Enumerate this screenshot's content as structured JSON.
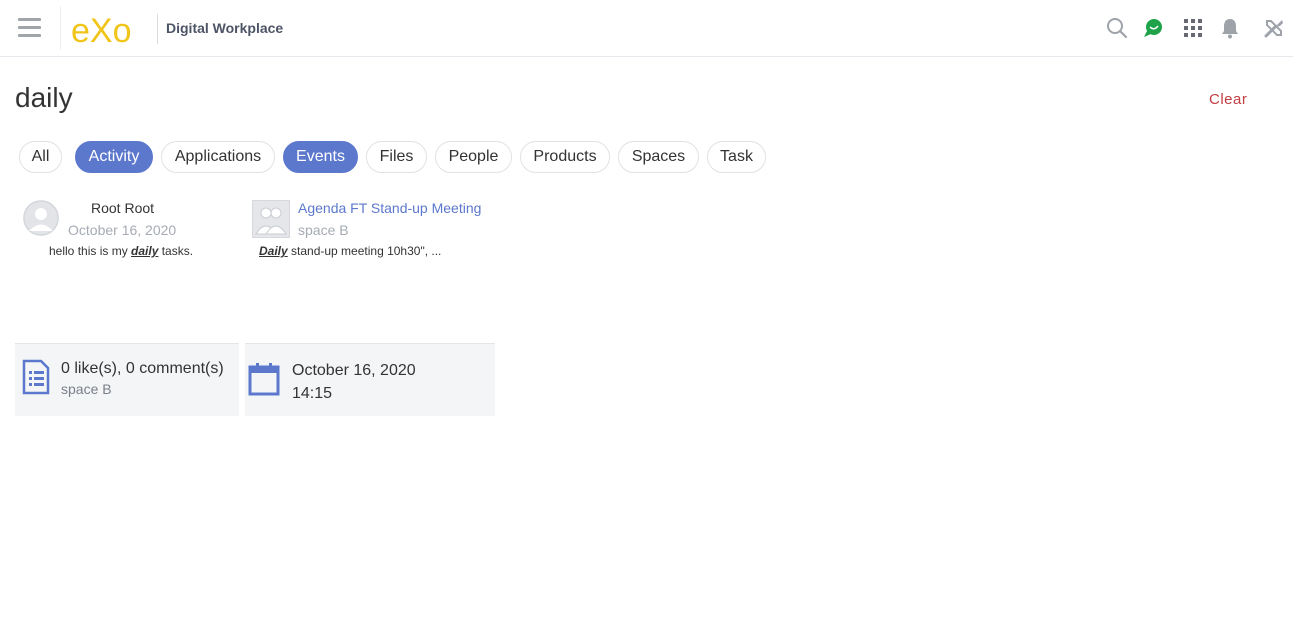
{
  "header": {
    "brand_title": "Digital Workplace",
    "logo_text": "eXo",
    "icons": [
      "menu-icon",
      "search-icon",
      "chat-icon",
      "apps-grid-icon",
      "bell-icon",
      "tools-icon"
    ],
    "colors": {
      "logo": "#f0c419",
      "chat": "#1fa34a",
      "icons": "#9ea3aa"
    }
  },
  "search": {
    "query": "daily",
    "clear_label": "Clear"
  },
  "filters": [
    {
      "label": "All",
      "active": false
    },
    {
      "label": "Activity",
      "active": true
    },
    {
      "label": "Applications",
      "active": false
    },
    {
      "label": "Events",
      "active": true
    },
    {
      "label": "Files",
      "active": false
    },
    {
      "label": "People",
      "active": false
    },
    {
      "label": "Products",
      "active": false
    },
    {
      "label": "Spaces",
      "active": false
    },
    {
      "label": "Task",
      "active": false
    }
  ],
  "results": {
    "activity": {
      "author": "Root Root",
      "date": "October 16, 2020",
      "snippet_before": "hello this is my ",
      "snippet_match": "daily",
      "snippet_after": " tasks.",
      "stats": "0 like(s), 0 comment(s)",
      "space": "space B"
    },
    "event": {
      "title": "Agenda FT Stand-up Meeting",
      "space": "space B",
      "snippet_match": "Daily",
      "snippet_after": " stand-up meeting 10h30\", ...",
      "date": "October 16, 2020",
      "time": "14:15"
    }
  },
  "accent_color": "#5c78cd",
  "clear_color": "#c13e42"
}
